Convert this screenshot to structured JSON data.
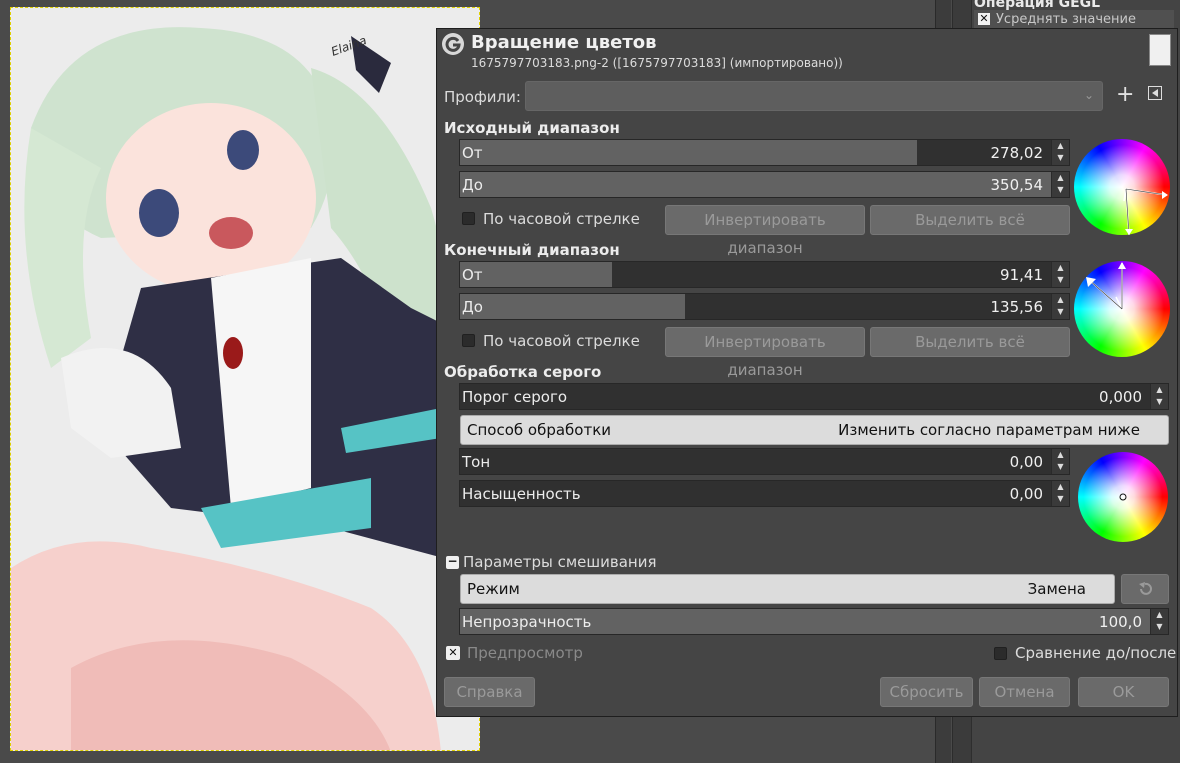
{
  "dock": {
    "title": "Операция GEGL",
    "row_label": "Усреднять значение"
  },
  "image": {
    "signature": "Elaina"
  },
  "dialog": {
    "title": "Вращение цветов",
    "subtitle": "1675797703183.png-2 ([1675797703183] (импортировано))",
    "profiles_label": "Профили:",
    "profiles_value": "",
    "source": {
      "heading": "Исходный диапазон",
      "from_label": "От",
      "from_value": "278,02",
      "from_fill": 0.75,
      "to_label": "До",
      "to_value": "350,54",
      "to_fill": 0.97,
      "clockwise_label": "По часовой стрелке",
      "invert_label": "Инвертировать диапазон",
      "select_all_label": "Выделить всё"
    },
    "dest": {
      "heading": "Конечный диапазон",
      "from_label": "От",
      "from_value": "91,41",
      "from_fill": 0.25,
      "to_label": "До",
      "to_value": "135,56",
      "to_fill": 0.37,
      "clockwise_label": "По часовой стрелке",
      "invert_label": "Инвертировать диапазон",
      "select_all_label": "Выделить всё"
    },
    "gray": {
      "heading": "Обработка серого",
      "threshold_label": "Порог серого",
      "threshold_value": "0,000",
      "mode_label": "Способ обработки",
      "mode_value": "Изменить согласно параметрам ниже",
      "hue_label": "Тон",
      "hue_value": "0,00",
      "sat_label": "Насыщенность",
      "sat_value": "0,00"
    },
    "blend": {
      "heading": "Параметры смешивания",
      "mode_label": "Режим",
      "mode_value": "Замена",
      "opacity_label": "Непрозрачность",
      "opacity_value": "100,0",
      "opacity_fill": 1.0
    },
    "preview_label": "Предпросмотр",
    "compare_label": "Сравнение до/после",
    "help_label": "Справка",
    "reset_label": "Сбросить",
    "cancel_label": "Отмена",
    "ok_label": "OK"
  },
  "colors": {
    "accent": "#e0d000",
    "bg": "#454545",
    "slider_bg": "#303030",
    "slider_fill": "#626262"
  }
}
